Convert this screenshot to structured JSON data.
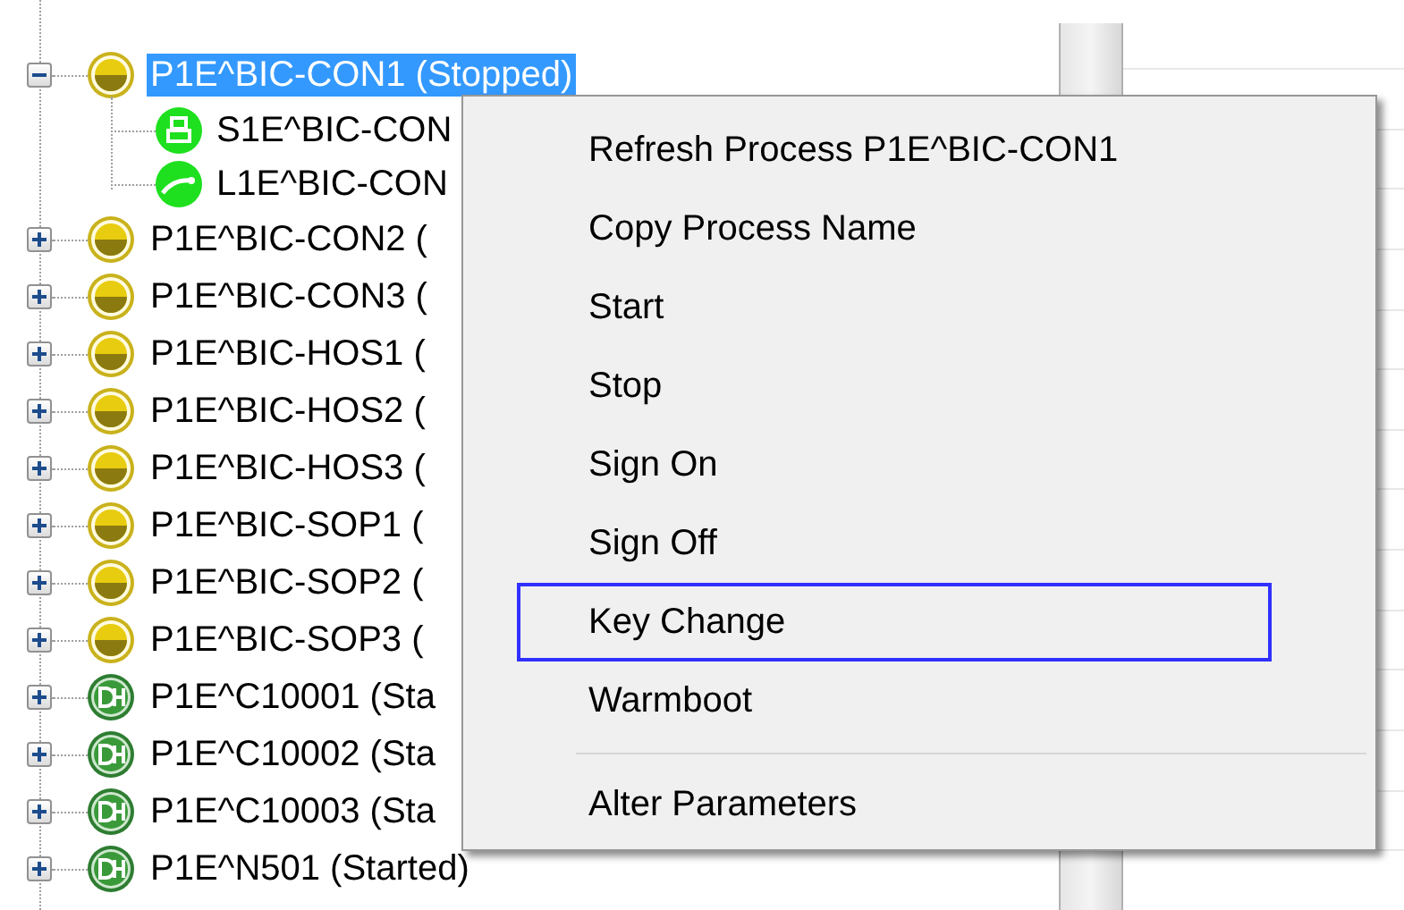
{
  "tree": [
    {
      "label": "P1E^BIC-CON1 (Stopped)",
      "kind": "stopped",
      "selected": true,
      "expanded": true,
      "children": [
        {
          "label": "S1E^BIC-CON",
          "kind": "printer",
          "selected": false
        },
        {
          "label": "L1E^BIC-CON",
          "kind": "line",
          "selected": false
        }
      ]
    },
    {
      "label": "P1E^BIC-CON2 (",
      "kind": "stopped",
      "selected": false,
      "expanded": false
    },
    {
      "label": "P1E^BIC-CON3 (",
      "kind": "stopped",
      "selected": false,
      "expanded": false
    },
    {
      "label": "P1E^BIC-HOS1 (",
      "kind": "stopped",
      "selected": false,
      "expanded": false
    },
    {
      "label": "P1E^BIC-HOS2 (",
      "kind": "stopped",
      "selected": false,
      "expanded": false
    },
    {
      "label": "P1E^BIC-HOS3 (",
      "kind": "stopped",
      "selected": false,
      "expanded": false
    },
    {
      "label": "P1E^BIC-SOP1 (",
      "kind": "stopped",
      "selected": false,
      "expanded": false
    },
    {
      "label": "P1E^BIC-SOP2 (",
      "kind": "stopped",
      "selected": false,
      "expanded": false
    },
    {
      "label": "P1E^BIC-SOP3 (",
      "kind": "stopped",
      "selected": false,
      "expanded": false
    },
    {
      "label": "P1E^C10001 (Sta",
      "kind": "started",
      "selected": false,
      "expanded": false
    },
    {
      "label": "P1E^C10002 (Sta",
      "kind": "started",
      "selected": false,
      "expanded": false
    },
    {
      "label": "P1E^C10003 (Sta",
      "kind": "started",
      "selected": false,
      "expanded": false
    },
    {
      "label": "P1E^N501 (Started)",
      "kind": "started",
      "selected": false,
      "expanded": false
    }
  ],
  "context_menu": [
    {
      "label": "Refresh Process P1E^BIC-CON1",
      "kind": "item",
      "selected": false
    },
    {
      "label": "Copy Process Name",
      "kind": "item",
      "selected": false
    },
    {
      "label": "Start",
      "kind": "item",
      "selected": false
    },
    {
      "label": "Stop",
      "kind": "item",
      "selected": false
    },
    {
      "label": "Sign On",
      "kind": "item",
      "selected": false
    },
    {
      "label": "Sign Off",
      "kind": "item",
      "selected": false
    },
    {
      "label": "Key Change",
      "kind": "item",
      "selected": true
    },
    {
      "label": "Warmboot",
      "kind": "item",
      "selected": false
    },
    {
      "kind": "separator"
    },
    {
      "label": "Alter Parameters",
      "kind": "item",
      "selected": false
    }
  ]
}
